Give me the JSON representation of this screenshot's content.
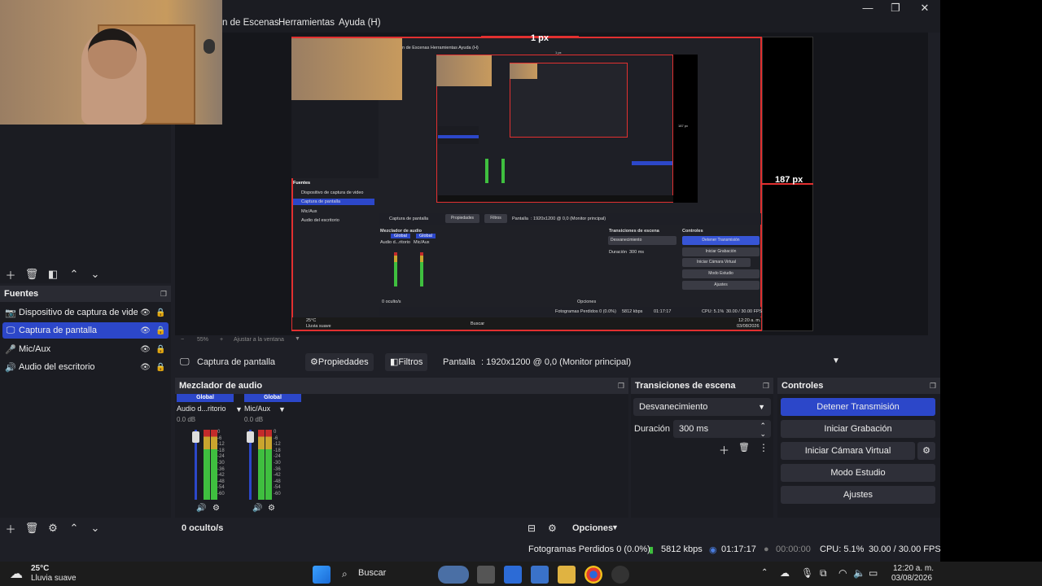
{
  "menu": {
    "items": [
      "n de Escenas",
      "Herramientas",
      "Ayuda (H)"
    ]
  },
  "window_controls": {
    "minimize": "—",
    "maximize": "❐",
    "close": "✕"
  },
  "preview": {
    "size_top_label": "1 px",
    "size_right_label": "187 px",
    "zoom_value": "55%",
    "zoom_fit": "Ajustar a la ventana",
    "zoom_minus": "−",
    "zoom_plus": "+"
  },
  "sources_panel": {
    "title": "Fuentes",
    "items": [
      {
        "label": "Dispositivo de captura de video",
        "icon": "camera-icon"
      },
      {
        "label": "Captura de pantalla",
        "icon": "monitor-icon",
        "selected": true
      },
      {
        "label": "Mic/Aux",
        "icon": "microphone-icon"
      },
      {
        "label": "Audio del escritorio",
        "icon": "speaker-icon"
      }
    ]
  },
  "properties_bar": {
    "source_name": "Captura de pantalla",
    "properties_button": "Propiedades",
    "filters_button": "Filtros",
    "screen_label": "Pantalla",
    "screen_value": ": 1920x1200 @ 0,0 (Monitor principal)"
  },
  "mixer": {
    "title": "Mezclador de audio",
    "channels": [
      {
        "badge": "Global",
        "name": "Audio d...ritorio",
        "db": "0.0 dB"
      },
      {
        "badge": "Global",
        "name": "Mic/Aux",
        "db": "0.0 dB"
      }
    ],
    "scale": [
      "0",
      "-6",
      "-12",
      "-18",
      "-24",
      "-30",
      "-36",
      "-42",
      "-48",
      "-54",
      "-60"
    ],
    "hidden_count": "0 oculto/s",
    "options": "Opciones"
  },
  "transitions": {
    "title": "Transiciones de escena",
    "selected": "Desvanecimiento",
    "duration_label": "Duración",
    "duration_value": "300 ms"
  },
  "controls": {
    "title": "Controles",
    "stop_stream": "Detener Transmisión",
    "start_recording": "Iniciar Grabación",
    "start_virtual_cam": "Iniciar Cámara Virtual",
    "studio_mode": "Modo Estudio",
    "settings": "Ajustes"
  },
  "status": {
    "dropped_frames": "Fotogramas Perdidos 0 (0.0%)",
    "bitrate": "5812 kbps",
    "stream_time": "01:17:17",
    "rec_time": "00:00:00",
    "cpu": "CPU: 5.1%",
    "fps": "30.00 / 30.00 FPS"
  },
  "taskbar": {
    "weather_temp": "25°C",
    "weather_desc": "Lluvia suave",
    "search": "Buscar",
    "time": "12:20 a. m.",
    "date": "03/08/2026"
  },
  "inner_preview": {
    "menu": "n de Escenas  Herramientas  Ayuda (H)",
    "sources": [
      "Dispositivo de captura de video",
      "Captura de pantalla",
      "Mic/Aux",
      "Audio del escritorio"
    ],
    "fuentes": "Fuentes",
    "source_name": "Captura de pantalla",
    "props": "Propiedades",
    "filters": "Filtros",
    "screen": "Pantalla",
    "screen_value": ": 1920x1200 @ 0,0 (Monitor principal)",
    "mixer": "Mezclador de audio",
    "transitions": "Transiciones de escena",
    "controls": "Controles",
    "fade": "Desvanecimiento",
    "duration": "Duración",
    "duration_value": "300 ms",
    "stop": "Detener Transmisión",
    "rec": "Iniciar Grabación",
    "vcam": "Iniciar Cámara Virtual",
    "studio": "Modo Estudio",
    "settings": "Ajustes",
    "global": "Global",
    "ch1": "Audio d...ritorio",
    "ch2": "Mic/Aux",
    "hidden": "0 oculto/s",
    "options": "Opciones",
    "status": "Fotogramas Perdidos 0 (0.0%)",
    "bitrate": "5812 kbps",
    "time": "01:17:17",
    "cpu": "CPU: 5.1%",
    "fps": "30.00 / 30.00 FPS",
    "temp": "25°C",
    "weather": "Lluvia suave",
    "search": "Buscar",
    "clock": "12:20 a. m.",
    "date": "03/08/2026",
    "px_top": "1 px",
    "px_right": "187 px"
  }
}
